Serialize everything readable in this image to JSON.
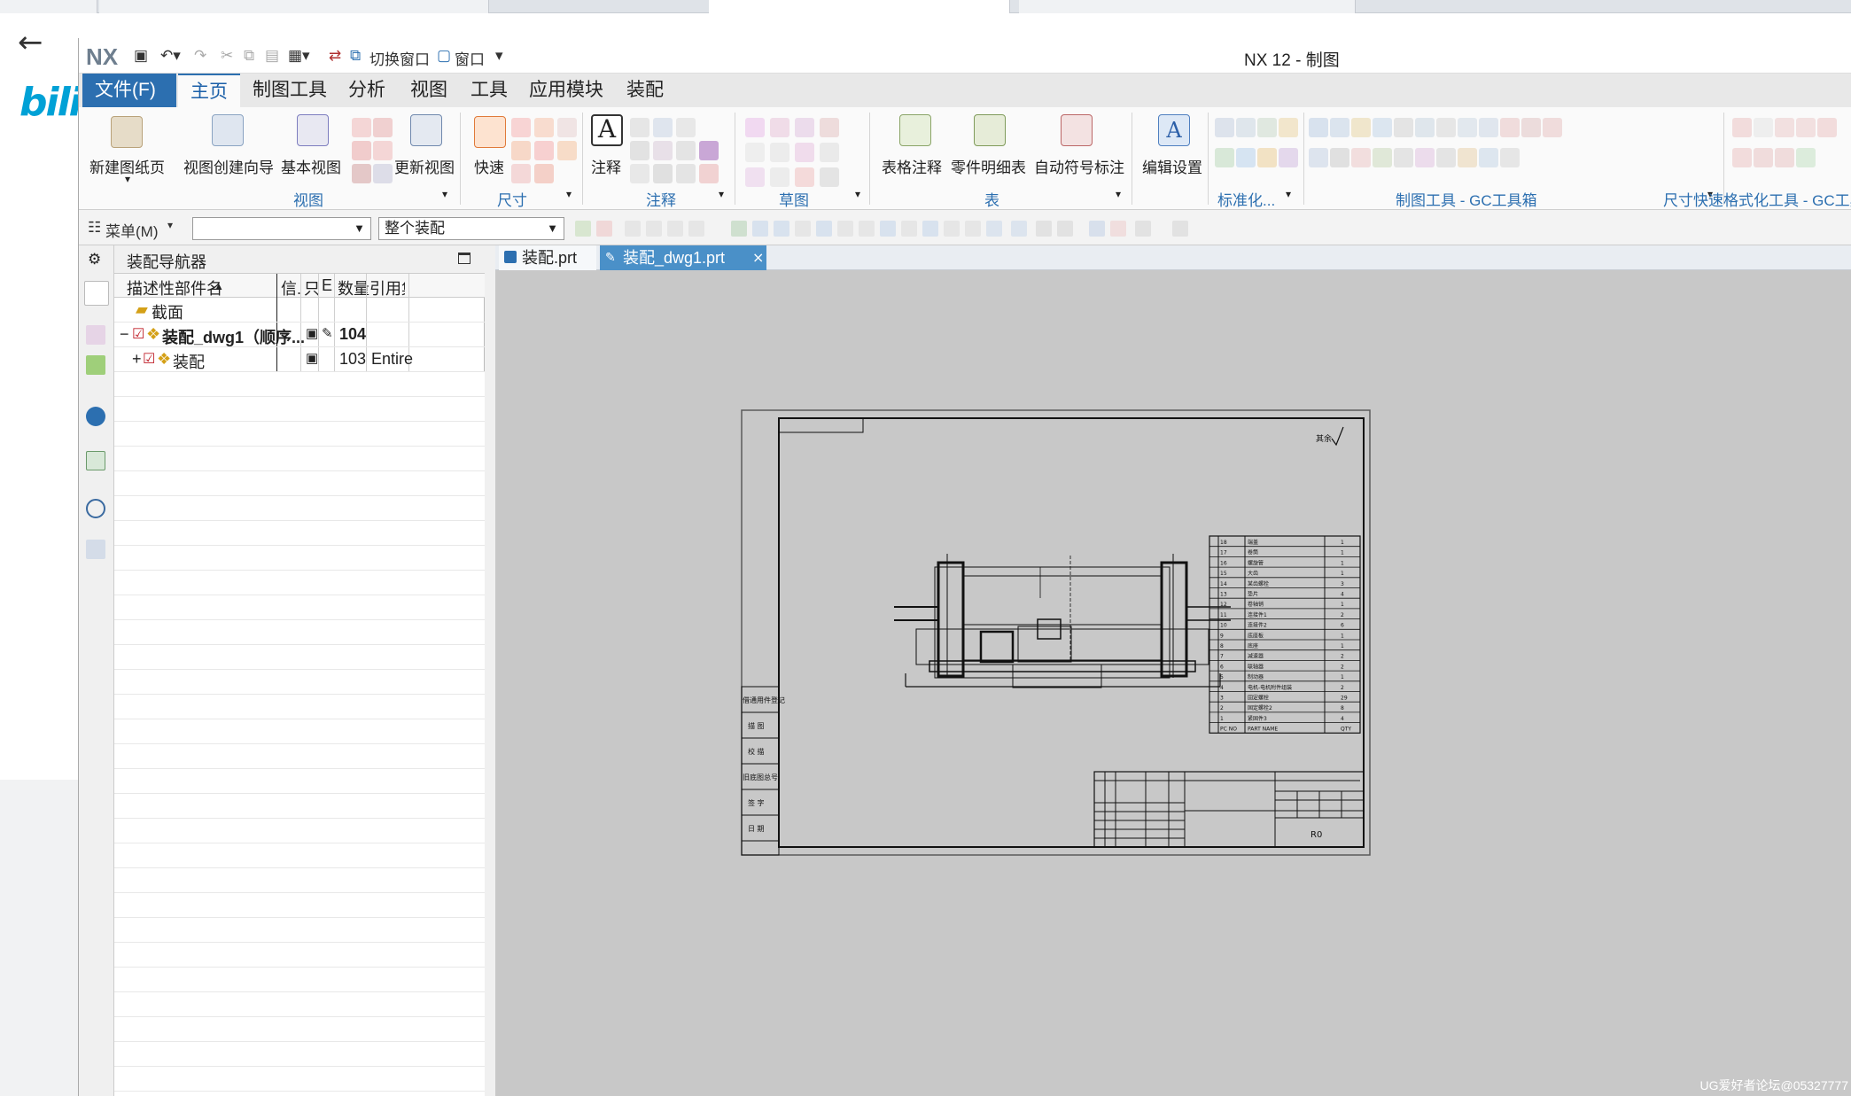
{
  "app": {
    "title": "NX 12 - 制图",
    "logo": "NX",
    "quick_access": {
      "switch_window": "切换窗口",
      "window": "窗口"
    }
  },
  "menu_tabs": [
    "文件(F)",
    "主页",
    "制图工具",
    "分析",
    "视图",
    "工具",
    "应用模块",
    "装配"
  ],
  "ribbon": {
    "new_sheet": "新建图纸页",
    "view_wizard": "视图创建向导",
    "base_view": "基本视图",
    "update_view": "更新视图",
    "quick_dim": "快速",
    "note": "注释",
    "table_note": "表格注释",
    "parts_list": "零件明细表",
    "auto_balloon": "自动符号标注",
    "edit_settings": "编辑设置",
    "groups": {
      "view": "视图",
      "dimension": "尺寸",
      "annotation": "注释",
      "sketch": "草图",
      "table": "表",
      "standard": "标准化...",
      "gc_tools": "制图工具 - GC工具箱",
      "dim_format": "尺寸快速格式化工具 - GC工具"
    }
  },
  "toolbar2": {
    "menu": "菜单(M)",
    "selection_filter": "",
    "scope": "整个装配"
  },
  "navigator": {
    "title": "装配导航器",
    "columns": [
      "描述性部件名",
      "信.",
      "只",
      "E",
      "数量",
      "引用集"
    ],
    "rows": [
      {
        "name": "截面",
        "qty": "",
        "ref": ""
      },
      {
        "name": "装配_dwg1（顺序...",
        "qty": "104",
        "ref": ""
      },
      {
        "name": "装配",
        "qty": "103",
        "ref": "Entire"
      }
    ]
  },
  "graphic_tabs": [
    "装配.prt",
    "装配_dwg1.prt"
  ],
  "drawing": {
    "roughness_note": "其余",
    "left_block": [
      "借通用件登记",
      "描 图",
      "校 描",
      "旧底图总号",
      "签 字",
      "日 期"
    ],
    "bom": [
      {
        "no": "18",
        "name": "端盖",
        "qty": "1"
      },
      {
        "no": "17",
        "name": "卷筒",
        "qty": "1"
      },
      {
        "no": "16",
        "name": "螺旋管",
        "qty": "1"
      },
      {
        "no": "15",
        "name": "大齿",
        "qty": "1"
      },
      {
        "no": "14",
        "name": "某齿螺栓",
        "qty": "3"
      },
      {
        "no": "13",
        "name": "垫片",
        "qty": "4"
      },
      {
        "no": "12",
        "name": "卷轴销",
        "qty": "1"
      },
      {
        "no": "11",
        "name": "连接件1",
        "qty": "2"
      },
      {
        "no": "10",
        "name": "连接件2",
        "qty": "6"
      },
      {
        "no": "9",
        "name": "底座板",
        "qty": "1"
      },
      {
        "no": "8",
        "name": "底座",
        "qty": "1"
      },
      {
        "no": "7",
        "name": "减速器",
        "qty": "2"
      },
      {
        "no": "6",
        "name": "联轴器",
        "qty": "2"
      },
      {
        "no": "5",
        "name": "制动器",
        "qty": "1"
      },
      {
        "no": "4",
        "name": "电机-电机附件组装",
        "qty": "2"
      },
      {
        "no": "3",
        "name": "固定螺栓",
        "qty": "29"
      },
      {
        "no": "2",
        "name": "固定螺栓2",
        "qty": "8"
      },
      {
        "no": "1",
        "name": "紧固件3",
        "qty": "4"
      }
    ],
    "bom_header": {
      "no": "PC NO",
      "name": "PART NAME",
      "qty": "QTY"
    },
    "title_block_code": "R0"
  },
  "watermark": "UG爱好者论坛@05327777",
  "colors": {
    "accent": "#2c6fb0",
    "graphics_bg": "#c8c8c8"
  }
}
